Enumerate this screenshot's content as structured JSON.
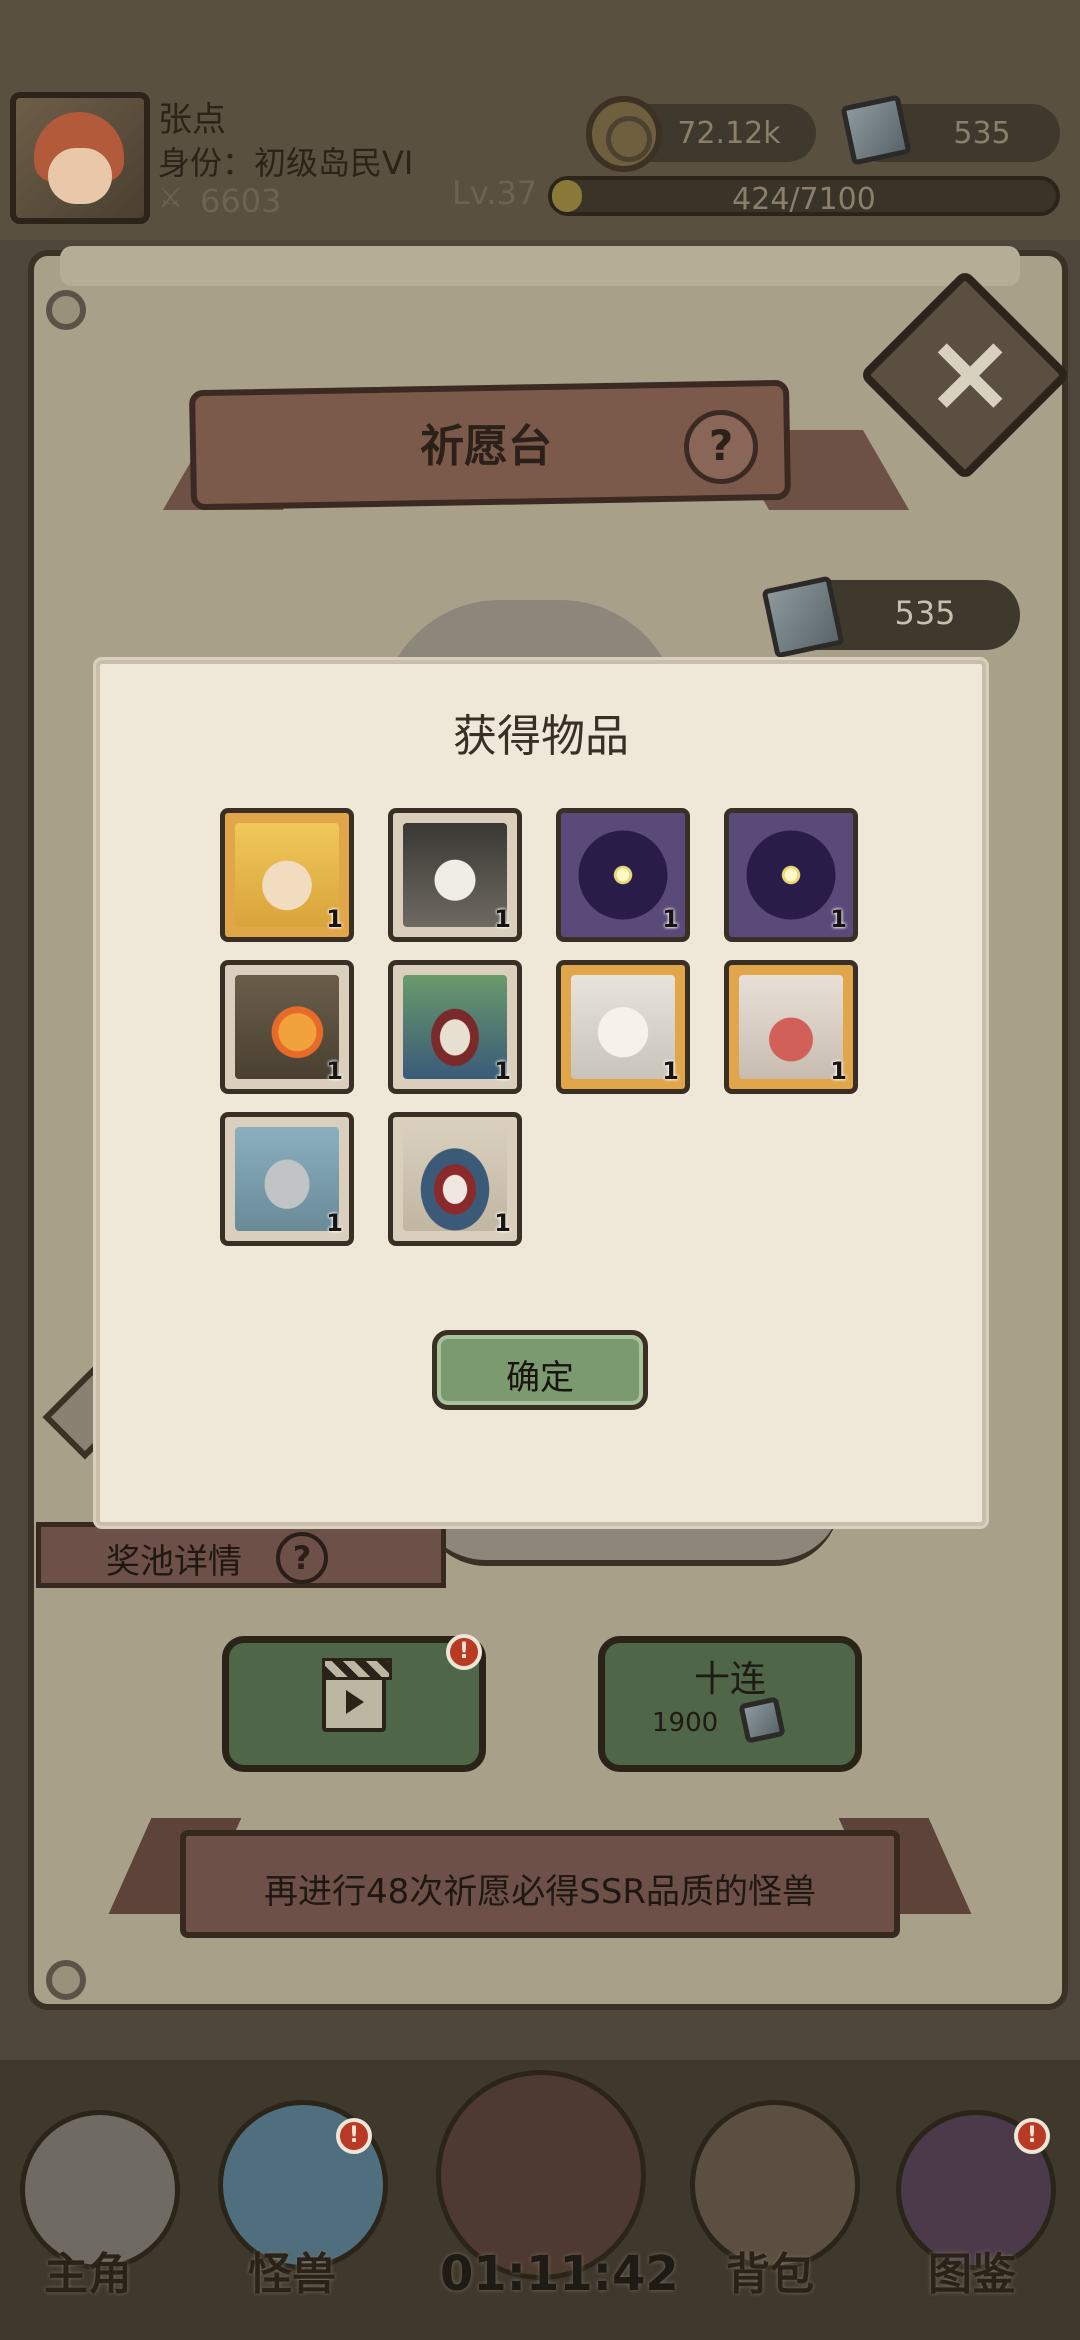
{
  "player": {
    "name": "张点",
    "identity": "身份：初级岛民VI",
    "power": "6603",
    "level": "Lv.37",
    "xp_text": "424/7100",
    "xp_fraction": 0.06
  },
  "currency": {
    "coins": "72.12k",
    "gems": "535"
  },
  "wish": {
    "title": "祈愿台",
    "help_glyph": "?",
    "gem_balance": "535",
    "pool_details": "奖池详情",
    "ten_pull_label": "十连",
    "ten_pull_cost": "1900",
    "pity_text": "再进行48次祈愿必得SSR品质的怪兽"
  },
  "dialog": {
    "title": "获得物品",
    "confirm_label": "确定",
    "items": [
      {
        "name": "blonde-girl",
        "quality": "gold",
        "count": "1"
      },
      {
        "name": "black-hair-ghost",
        "quality": "silver",
        "count": "1"
      },
      {
        "name": "dark-orb",
        "quality": "purple",
        "count": "1"
      },
      {
        "name": "dark-orb",
        "quality": "purple",
        "count": "1"
      },
      {
        "name": "fire-spirit",
        "quality": "silver",
        "count": "1"
      },
      {
        "name": "mimic",
        "quality": "silver",
        "count": "1"
      },
      {
        "name": "nun-girl",
        "quality": "gold",
        "count": "1"
      },
      {
        "name": "red-girl",
        "quality": "gold",
        "count": "1"
      },
      {
        "name": "stone-golem",
        "quality": "silver",
        "count": "1"
      },
      {
        "name": "worm-mouth",
        "quality": "silver",
        "count": "1"
      }
    ]
  },
  "nav": {
    "hero": "主角",
    "monster": "怪兽",
    "bag": "背包",
    "book": "图鉴",
    "timer": "01:11:42"
  },
  "badges": {
    "alert": "!"
  },
  "icons": {
    "coin": "coin-icon",
    "gem": "gem-icon",
    "close": "close-icon",
    "video": "video-icon",
    "help": "help-icon"
  }
}
